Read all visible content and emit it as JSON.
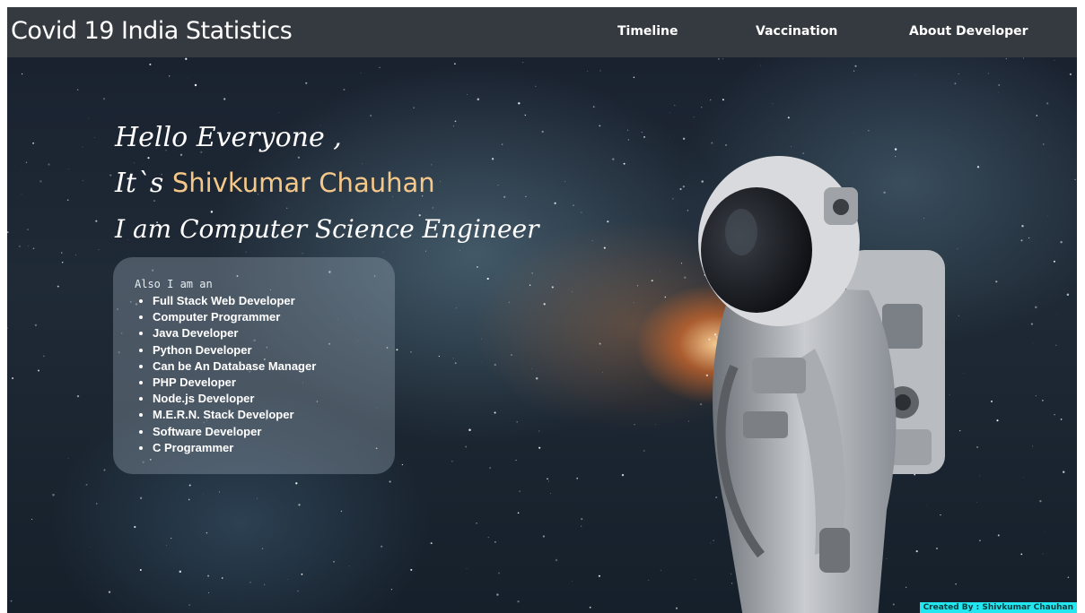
{
  "navbar": {
    "brand": "Covid 19 India Statistics",
    "links": [
      {
        "label": "Timeline"
      },
      {
        "label": "Vaccination"
      },
      {
        "label": "About Developer"
      }
    ]
  },
  "hero": {
    "line1": "Hello Everyone ,",
    "line2_prefix": "It`s",
    "line2_name": "Shivkumar Chauhan",
    "line3": "I am Computer Science Engineer"
  },
  "skills": {
    "intro": "Also I am an",
    "items": [
      "Full Stack Web Developer",
      "Computer Programmer",
      "Java Developer",
      "Python Developer",
      "Can be An Database Manager",
      "PHP Developer",
      "Node.js Developer",
      "M.E.R.N. Stack Developer",
      "Software Developer",
      "C Programmer"
    ]
  },
  "footer": {
    "credit": "Created By : Shivkumar Chauhan"
  },
  "colors": {
    "navbar_bg": "#343a40",
    "name_highlight": "#f5c88a",
    "credit_badge": "#22e6f0"
  },
  "icons": {
    "astronaut": "astronaut-illustration"
  }
}
